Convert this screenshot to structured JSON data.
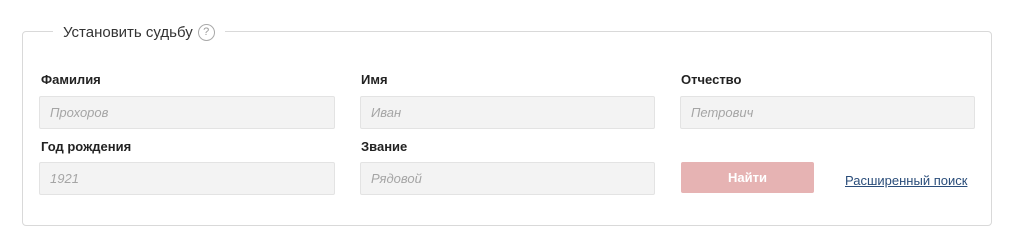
{
  "form": {
    "title": "Установить судьбу",
    "help_symbol": "?",
    "fields": {
      "surname": {
        "label": "Фамилия",
        "placeholder": "Прохоров",
        "value": ""
      },
      "name": {
        "label": "Имя",
        "placeholder": "Иван",
        "value": ""
      },
      "patronymic": {
        "label": "Отчество",
        "placeholder": "Петрович",
        "value": ""
      },
      "birth_year": {
        "label": "Год рождения",
        "placeholder": "1921",
        "value": ""
      },
      "rank": {
        "label": "Звание",
        "placeholder": "Рядовой",
        "value": ""
      }
    },
    "search_button": "Найти",
    "advanced_search_link": "Расширенный поиск"
  },
  "colors": {
    "button_bg": "#e6b3b3",
    "link": "#2a4d7a",
    "field_bg": "#f3f3f3",
    "border": "#d9d9d9"
  },
  "icons": {
    "help": "question-circle-icon"
  }
}
